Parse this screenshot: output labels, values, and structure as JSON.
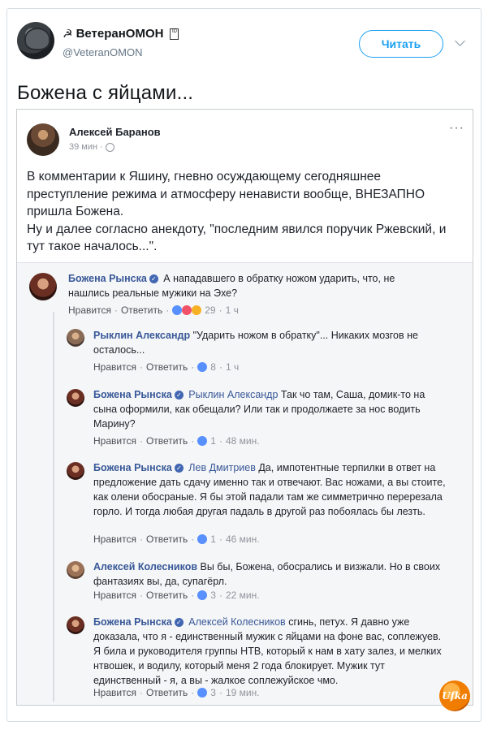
{
  "tweet": {
    "author_name": "ВетеранОМОН",
    "sickle_glyph": "☭",
    "id_badge": "ID",
    "handle": "@VeteranOMON",
    "follow_label": "Читать",
    "text": "Божена с яйцами..."
  },
  "fb_post": {
    "author": "Алексей Баранов",
    "time": "39 мин ·",
    "more": "···",
    "paragraphs": [
      "В комментарии к Яшину, гневно осуждающему сегодняшнее преступление режима и атмосферу ненависти вообще, ВНЕЗАПНО пришла Божена.",
      "Ну и далее согласно анекдоту, \"последним явился поручик Ржевский, и тут такое началось...\"."
    ]
  },
  "comments": [
    {
      "author": "Божена Рынска",
      "verified": true,
      "mention": "",
      "text": "А нападавшего в обратку ножом ударить, что, не нашлись реальные мужики на Эхе?",
      "like": "Нравится",
      "reply": "Ответить",
      "reactions": "29",
      "time": "1 ч"
    },
    {
      "author": "Рыклин Александр",
      "verified": false,
      "mention": "",
      "text": "\"Ударить ножом в обратку\"... Никаких мозгов не осталось...",
      "like": "Нравится",
      "reply": "Ответить",
      "reactions": "8",
      "time": "1 ч"
    },
    {
      "author": "Божена Рынска",
      "verified": true,
      "mention": "Рыклин Александр",
      "text": "Так чо там, Саша, домик-то на сына оформили, как обещали? Или так и продолжаете за нос водить Марину?",
      "like": "Нравится",
      "reply": "Ответить",
      "reactions": "1",
      "time": "48 мин."
    },
    {
      "author": "Божена Рынска",
      "verified": true,
      "mention": "Лев Дмитриев",
      "text": "Да, импотентные терпилки в ответ на предложение дать сдачу именно так и отвечают. Вас ножами, а вы стоите, как олени обосраные. Я бы этой падали там же симметрично перерезала горло. И тогда любая другая падаль в другой раз побоялась бы лезть.",
      "like": "Нравится",
      "reply": "Ответить",
      "reactions": "1",
      "time": "46 мин."
    },
    {
      "author": "Алексей Колесников",
      "verified": false,
      "mention": "",
      "text": "Вы бы, Божена, обосрались и визжали. Но в своих фантазиях вы, да, супагёрл.",
      "like": "Нравится",
      "reply": "Ответить",
      "reactions": "3",
      "time": "22 мин."
    },
    {
      "author": "Божена Рынска",
      "verified": true,
      "mention": "Алексей Колесников",
      "text": "сгинь, петух. Я давно уже доказала, что я - единственный мужик с яйцами на фоне вас, соплежуев. Я била и руководителя группы НТВ, который к нам в хату залез, и мелких нтвошек, и водилу, который меня 2 года блокирует. Мужик тут единственный - я, а вы - жалкое соплежуйское чмо.",
      "like": "Нравится",
      "reply": "Ответить",
      "reactions": "3",
      "time": "19 мин."
    }
  ],
  "watermark": "Ufka",
  "colors": {
    "link": "#385898",
    "follow": "#1da1f2",
    "like": "#5890ff"
  }
}
